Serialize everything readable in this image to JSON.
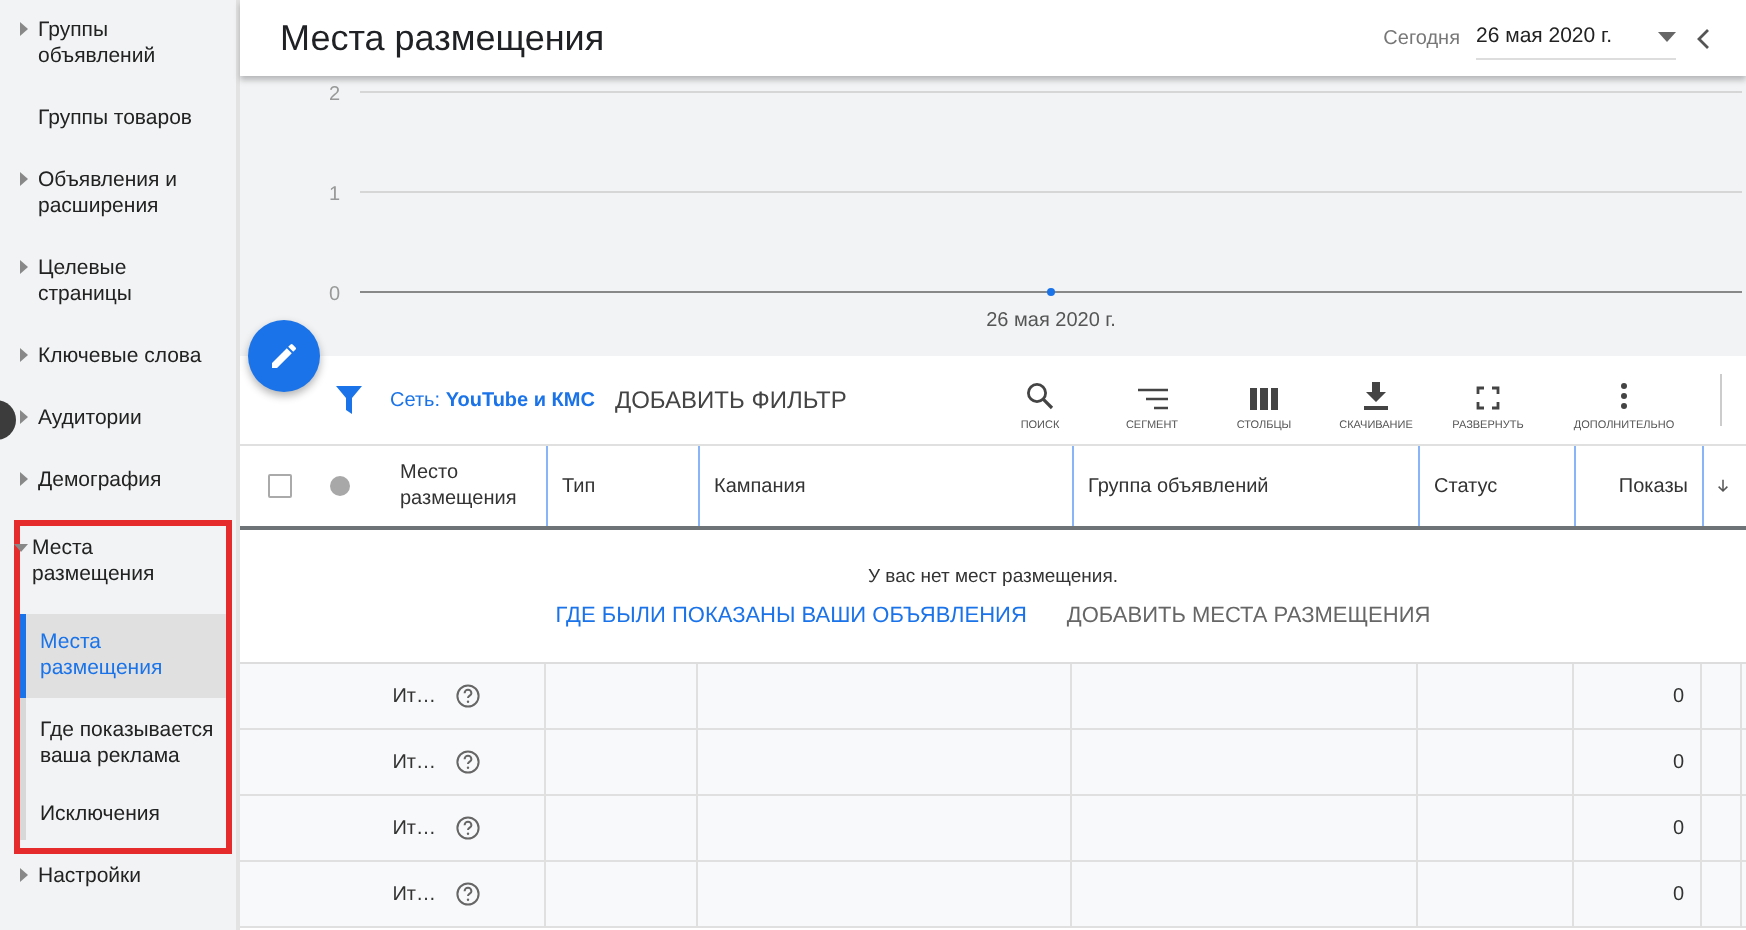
{
  "sidebar": {
    "items": [
      {
        "label": "Группы объявлений",
        "kind": "group",
        "expanded": false
      },
      {
        "label": "Группы товаров",
        "kind": "link"
      },
      {
        "label": "Объявления и расширения",
        "kind": "group",
        "expanded": false
      },
      {
        "label": "Целевые страницы",
        "kind": "group",
        "expanded": false
      },
      {
        "label": "Ключевые слова",
        "kind": "group",
        "expanded": false
      },
      {
        "label": "Аудитории",
        "kind": "group",
        "expanded": false
      },
      {
        "label": "Демография",
        "kind": "group",
        "expanded": false
      },
      {
        "label": "Места размещения",
        "kind": "group",
        "expanded": true,
        "highlighted": true,
        "children": [
          {
            "label": "Места размещения",
            "selected": true
          },
          {
            "label": "Где показывается ваша реклама",
            "selected": false
          },
          {
            "label": "Исключения",
            "selected": false
          }
        ]
      },
      {
        "label": "Настройки",
        "kind": "group",
        "expanded": false
      }
    ]
  },
  "header": {
    "title": "Места размещения",
    "date_label": "Сегодня",
    "date_value": "26 мая 2020 г."
  },
  "chart": {
    "chart_data": {
      "type": "line",
      "marker": "circle",
      "categories": [
        "26 мая 2020 г."
      ],
      "values": [
        0
      ],
      "ylim": [
        0,
        2
      ],
      "yticks": [
        0,
        1,
        2
      ]
    }
  },
  "toolbar": {
    "filter_prefix": "Сеть:",
    "filter_value": "YouTube и КМС",
    "add_filter": "ДОБАВИТЬ ФИЛЬТР",
    "tools": [
      {
        "kind": "search",
        "label": "ПОИСК"
      },
      {
        "kind": "segment",
        "label": "СЕГМЕНТ"
      },
      {
        "kind": "columns",
        "label": "СТОЛБЦЫ"
      },
      {
        "kind": "download",
        "label": "СКАЧИВАНИЕ"
      },
      {
        "kind": "expand",
        "label": "РАЗВЕРНУТЬ"
      },
      {
        "kind": "more",
        "label": "ДОПОЛНИТЕЛЬНО"
      }
    ]
  },
  "table": {
    "select_all_checked": false,
    "columns": [
      "Место размещения",
      "Тип",
      "Кампания",
      "Группа объявлений",
      "Статус",
      "Показы"
    ],
    "empty_message": "У вас нет мест размещения.",
    "empty_actions": [
      {
        "label": "ГДЕ БЫЛИ ПОКАЗАНЫ ВАШИ ОБЪЯВЛЕНИЯ",
        "kind": "primary"
      },
      {
        "label": "ДОБАВИТЬ МЕСТА РАЗМЕЩЕНИЯ",
        "kind": "secondary"
      }
    ],
    "rows": [
      {
        "label": "Ит…",
        "impressions": "0"
      },
      {
        "label": "Ит…",
        "impressions": "0"
      },
      {
        "label": "Ит…",
        "impressions": "0"
      },
      {
        "label": "Ит…",
        "impressions": "0"
      }
    ]
  }
}
